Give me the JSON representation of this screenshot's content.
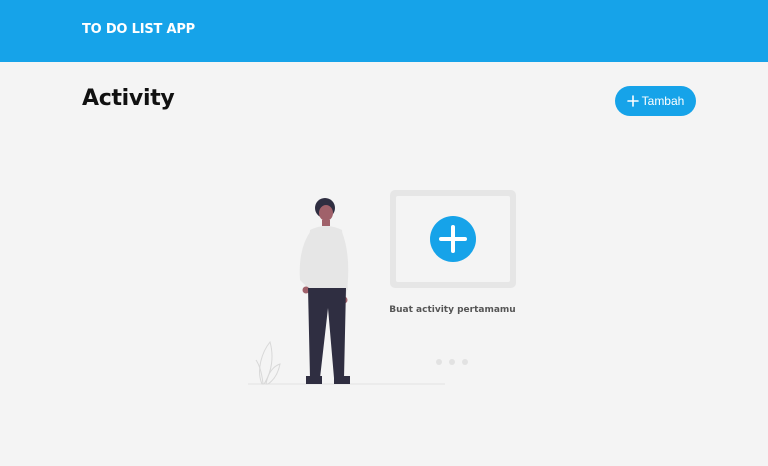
{
  "header": {
    "title": "TO DO LIST APP"
  },
  "page": {
    "title": "Activity"
  },
  "toolbar": {
    "add_label": "Tambah",
    "add_icon": "plus-icon"
  },
  "empty_state": {
    "caption": "Buat activity pertamamu",
    "icon": "plus-circle-icon"
  },
  "colors": {
    "accent": "#16a3e9",
    "background": "#f4f4f4"
  }
}
